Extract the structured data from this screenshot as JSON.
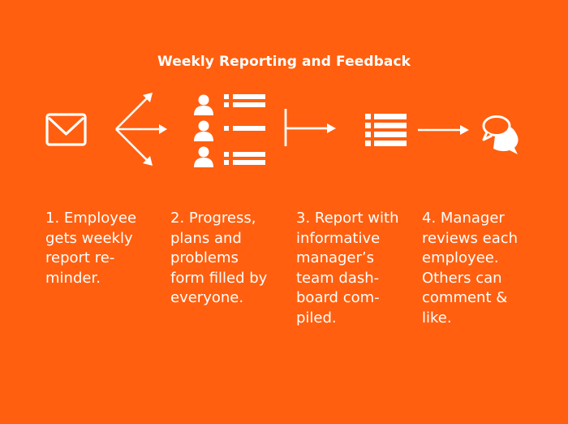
{
  "title": "Weekly Reporting and Feedback",
  "colors": {
    "background": "#ff5f0f",
    "foreground": "#ffffff"
  },
  "icons": [
    "envelope-icon",
    "branching-arrows-icon",
    "people-forms-icon",
    "merge-arrow-icon",
    "list-icon",
    "right-arrow-icon",
    "chat-bubbles-icon"
  ],
  "steps": [
    {
      "number": "1.",
      "text": "1. Employee\ngets weekly\nreport re-\nminder."
    },
    {
      "number": "2.",
      "text": "2. Progress,\nplans and\nproblems\nform filled by\neveryone."
    },
    {
      "number": "3.",
      "text": "3. Report with\ninformative\nmanager’s\nteam dash-\nboard com-\npiled."
    },
    {
      "number": "4.",
      "text": "4. Manager\nreviews each\nemployee.\nOthers can\ncomment &\nlike."
    }
  ]
}
